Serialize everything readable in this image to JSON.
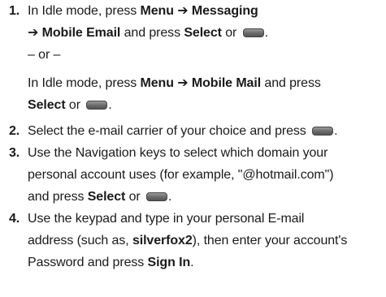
{
  "steps": [
    {
      "number": "1.",
      "lines": [
        {
          "t1": "In Idle mode, press ",
          "b1": "Menu",
          "t2": " ➔ ",
          "b2": "Messaging"
        },
        {
          "t0": "➔ ",
          "b1": "Mobile Email",
          "t2": " and press ",
          "b2": "Select",
          "t3": " or ",
          "t4": "."
        },
        {
          "or": "– or –"
        },
        {
          "t1": "In Idle mode, press ",
          "b1": "Menu",
          "t2": " ➔ ",
          "b2": "Mobile Mail",
          "t3": " and press"
        },
        {
          "b1": "Select",
          "t2": " or ",
          "t3": "."
        }
      ]
    },
    {
      "number": "2.",
      "lines": [
        {
          "t1": "Select the e-mail carrier of your choice and press ",
          "t2": "."
        }
      ]
    },
    {
      "number": "3.",
      "lines": [
        {
          "t1": "Use the Navigation keys to select which domain your"
        },
        {
          "t1": "personal account uses (for example, \"@hotmail.com\")"
        },
        {
          "t1": "and press ",
          "b1": "Select",
          "t2": " or ",
          "t3": "."
        }
      ]
    },
    {
      "number": "4.",
      "lines": [
        {
          "t1": "Use the keypad and type in your personal E-mail"
        },
        {
          "t1": "address (such as, ",
          "b1": "silverfox2",
          "t2": "), then enter your account's"
        },
        {
          "t1": "Password and press ",
          "b1": "Sign In",
          "t2": "."
        }
      ]
    }
  ],
  "icons": {
    "soft_key": "soft-key-icon"
  }
}
